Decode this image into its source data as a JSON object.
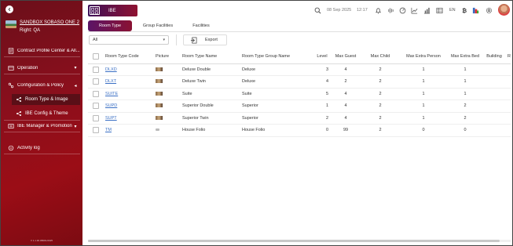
{
  "sidebar": {
    "hotel_name": "SANDBOX SOBASO ONE 2",
    "right": "Right: QA",
    "items": [
      {
        "label": "Contract Profile Center & All...",
        "icon": "contract-icon"
      },
      {
        "label": "Operation",
        "icon": "operation-icon"
      },
      {
        "label": "Configuration & Policy",
        "icon": "configuration-icon"
      },
      {
        "label": "IBE Manager & Promotion",
        "icon": "ibe-manager-icon"
      },
      {
        "label": "Activity log",
        "icon": "activity-log-icon"
      }
    ],
    "sub_items": [
      {
        "label": "Room Type & Image",
        "icon": "room-type-icon"
      },
      {
        "label": "IBE Config & Theme",
        "icon": "ibe-config-icon"
      }
    ],
    "version": "V 1.1.30.0B001/2025"
  },
  "header": {
    "module_label": "IBE",
    "date": "08 Sep 2025",
    "time": "12:17",
    "language": "EN"
  },
  "tabs": [
    {
      "label": "Room Type",
      "active": true
    },
    {
      "label": "Group Facilities",
      "active": false
    },
    {
      "label": "Facilities",
      "active": false
    }
  ],
  "filter": {
    "selected": "All"
  },
  "export_label": "Export",
  "table": {
    "columns": [
      "Room Type Code",
      "Picture",
      "Room Type Name",
      "Room Type Group Name",
      "Level",
      "Max Guest",
      "Max Child",
      "Max Extra Person",
      "Max Extra Bed",
      "Building",
      "Ro"
    ],
    "rows": [
      {
        "code": "DLXD",
        "picture": "photo",
        "name": "Deluxe Double",
        "group": "Deluxe",
        "level": "3",
        "max_guest": "4",
        "max_child": "2",
        "max_extra_person": "1",
        "max_extra_bed": "1",
        "building": ""
      },
      {
        "code": "DLXT",
        "picture": "photo",
        "name": "Deluxe Twin",
        "group": "Deluxe",
        "level": "4",
        "max_guest": "2",
        "max_child": "2",
        "max_extra_person": "1",
        "max_extra_bed": "1",
        "building": ""
      },
      {
        "code": "SUITE",
        "picture": "photo",
        "name": "Suite",
        "group": "Suite",
        "level": "5",
        "max_guest": "4",
        "max_child": "2",
        "max_extra_person": "1",
        "max_extra_bed": "1",
        "building": ""
      },
      {
        "code": "SUPD",
        "picture": "photo",
        "name": "Superior Double",
        "group": "Superior",
        "level": "1",
        "max_guest": "4",
        "max_child": "2",
        "max_extra_person": "1",
        "max_extra_bed": "2",
        "building": ""
      },
      {
        "code": "SUPT",
        "picture": "photo",
        "name": "Superior Twin",
        "group": "Superior",
        "level": "2",
        "max_guest": "4",
        "max_child": "2",
        "max_extra_person": "1",
        "max_extra_bed": "2",
        "building": ""
      },
      {
        "code": "TM",
        "picture": "placeholder",
        "name": "House Folio",
        "group": "House Folio",
        "level": "0",
        "max_guest": "99",
        "max_child": "2",
        "max_extra_person": "0",
        "max_extra_bed": "0",
        "building": ""
      }
    ]
  },
  "colors": {
    "sidebar": "#8a0f1c",
    "accent": "#5b1466",
    "link": "#3a6fc4"
  }
}
